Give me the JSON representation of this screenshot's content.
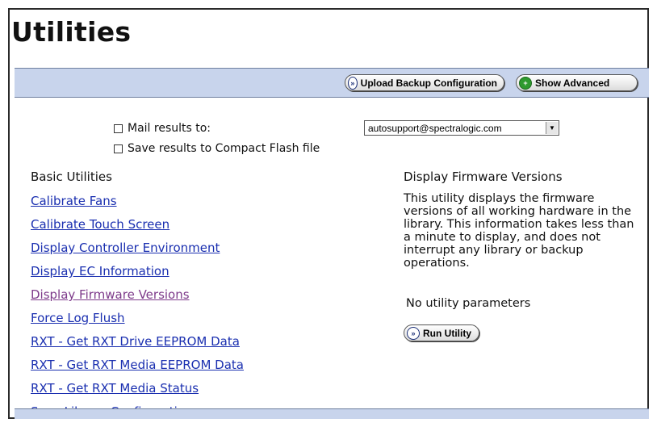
{
  "page": {
    "title": "Utilities"
  },
  "toolbar": {
    "upload_label": "Upload Backup Configuration",
    "advanced_label": "Show Advanced"
  },
  "options": {
    "mail_label": "Mail results to:",
    "mail_checked": false,
    "save_label": "Save results to Compact Flash file",
    "save_checked": false,
    "email_value": "autosupport@spectralogic.com"
  },
  "basic": {
    "heading": "Basic Utilities",
    "items": [
      {
        "label": "Calibrate Fans"
      },
      {
        "label": "Calibrate Touch Screen"
      },
      {
        "label": "Display Controller Environment"
      },
      {
        "label": "Display EC Information"
      },
      {
        "label": "Display Firmware Versions",
        "visited": true
      },
      {
        "label": "Force Log Flush"
      },
      {
        "label": "RXT - Get RXT Drive EEPROM Data"
      },
      {
        "label": "RXT - Get RXT Media EEPROM Data"
      },
      {
        "label": "RXT - Get RXT Media Status"
      },
      {
        "label": "Save Library Configuration"
      }
    ]
  },
  "detail": {
    "heading": "Display Firmware Versions",
    "description": "This utility displays the firmware versions of all working hardware in the library. This information takes less than a minute to display, and does not interrupt any library or backup operations.",
    "params": "No utility parameters",
    "run_label": "Run Utility"
  }
}
